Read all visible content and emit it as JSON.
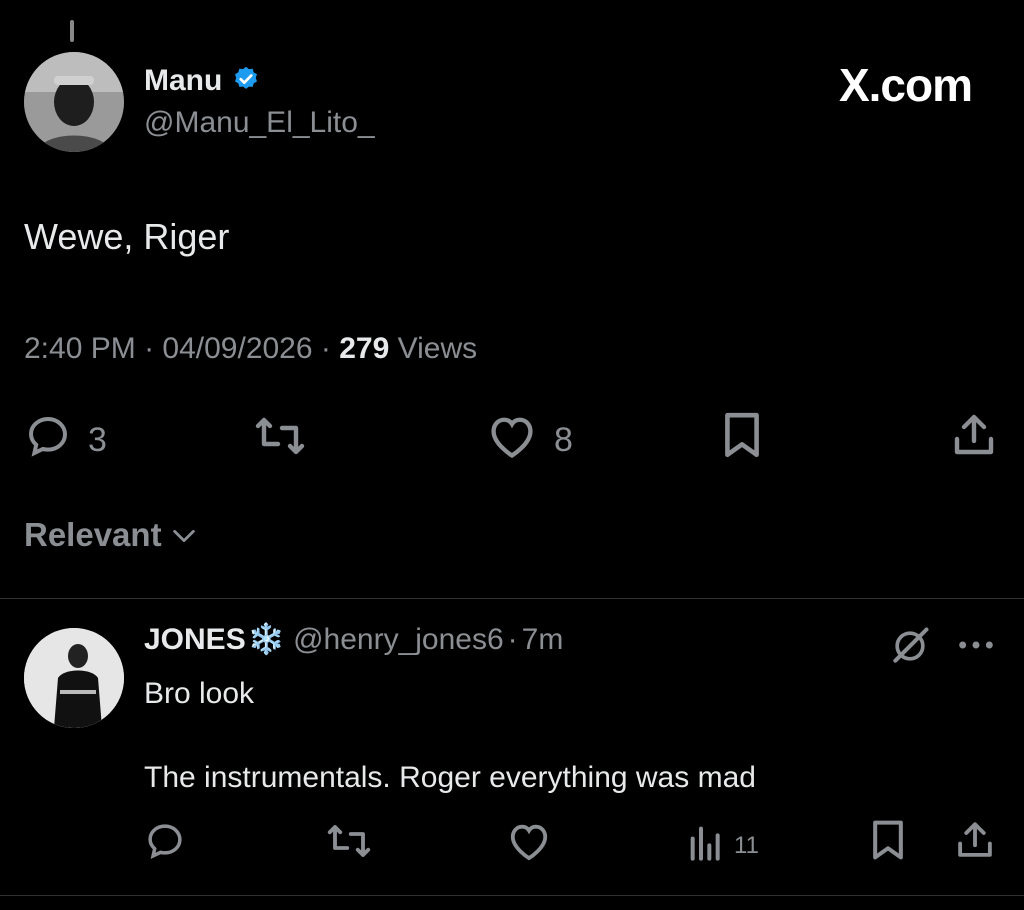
{
  "tweet": {
    "author_name": "Manu",
    "author_handle": "@Manu_El_Lito_",
    "text": "Wewe, Riger",
    "time": "2:40 PM",
    "date": "04/09/2026",
    "views_count": "279",
    "views_label": "Views",
    "reply_count": "3",
    "like_count": "8"
  },
  "brand": {
    "logo_text": "X.com"
  },
  "sort": {
    "label": "Relevant"
  },
  "reply": {
    "author_name": "JONES",
    "author_emoji": "❄️",
    "author_handle": "@henry_jones6",
    "age": "7m",
    "line1": "Bro look",
    "line2": "The instrumentals. Roger everything was mad",
    "views_count": "11"
  },
  "colors": {
    "verified": "#1d9bf0",
    "muted": "#8b8f93",
    "text": "#e7e9ea"
  }
}
